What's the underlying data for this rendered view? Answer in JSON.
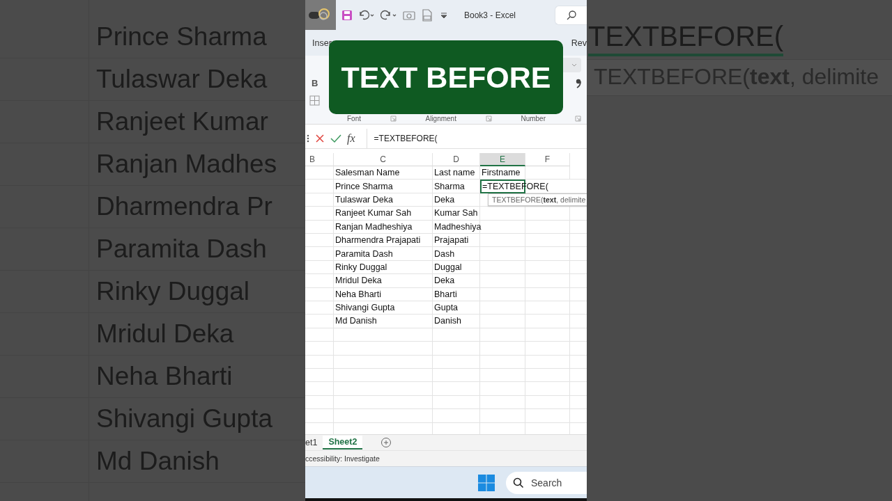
{
  "backdrop_left": {
    "rows": [
      "Prince Sharma",
      "Tulaswar Deka",
      "Ranjeet Kumar",
      "Ranjan Madhes",
      "Dharmendra Pr",
      "Paramita Dash",
      "Rinky Duggal",
      "Mridul Deka",
      "Neha Bharti",
      "Shivangi Gupta",
      "Md Danish"
    ]
  },
  "backdrop_right": {
    "formula": "TEXTBEFORE(",
    "tooltip": "TEXTBEFORE(**text**, delimite"
  },
  "title_bar": {
    "title": "Book3  -  Excel"
  },
  "ribbon": {
    "tabs": [
      "Inser",
      "Rev"
    ],
    "bold_button": "B",
    "groups": [
      "Font",
      "Alignment",
      "Number"
    ]
  },
  "overlay_title": "TEXT BEFORE",
  "formula_bar": {
    "function_label": "fx",
    "value": "=TEXTBEFORE("
  },
  "sheet": {
    "columns": [
      {
        "label": "B",
        "selected": false
      },
      {
        "label": "C",
        "selected": false
      },
      {
        "label": "D",
        "selected": false
      },
      {
        "label": "E",
        "selected": true
      },
      {
        "label": "F",
        "selected": false
      }
    ],
    "rows": [
      {
        "c": "Salesman Name",
        "d": "Last name",
        "e": "Firstname",
        "editing": false
      },
      {
        "c": "Prince Sharma",
        "d": "Sharma",
        "e": "=TEXTBEFORE(",
        "editing": true
      },
      {
        "c": "Tulaswar Deka",
        "d": "Deka",
        "editing": false
      },
      {
        "c": "Ranjeet Kumar Sah",
        "d": "Kumar Sah",
        "editing": false
      },
      {
        "c": "Ranjan Madheshiya",
        "d": "Madheshiya",
        "editing": false
      },
      {
        "c": "Dharmendra Prajapati",
        "d": "Prajapati",
        "editing": false
      },
      {
        "c": "Paramita Dash",
        "d": "Dash",
        "editing": false
      },
      {
        "c": "Rinky Duggal",
        "d": "Duggal",
        "editing": false
      },
      {
        "c": "Mridul Deka",
        "d": "Deka",
        "editing": false
      },
      {
        "c": "Neha Bharti",
        "d": "Bharti",
        "editing": false
      },
      {
        "c": "Shivangi Gupta",
        "d": "Gupta",
        "editing": false
      },
      {
        "c": "Md Danish",
        "d": "Danish",
        "editing": false
      }
    ],
    "tooltip": "TEXTBEFORE(**text**, delimite"
  },
  "sheet_tabs": [
    {
      "label": "et1",
      "selected": false
    },
    {
      "label": "Sheet2",
      "selected": true
    }
  ],
  "status_bar": "ccessibility: Investigate",
  "taskbar": {
    "search_placeholder": "Search"
  }
}
